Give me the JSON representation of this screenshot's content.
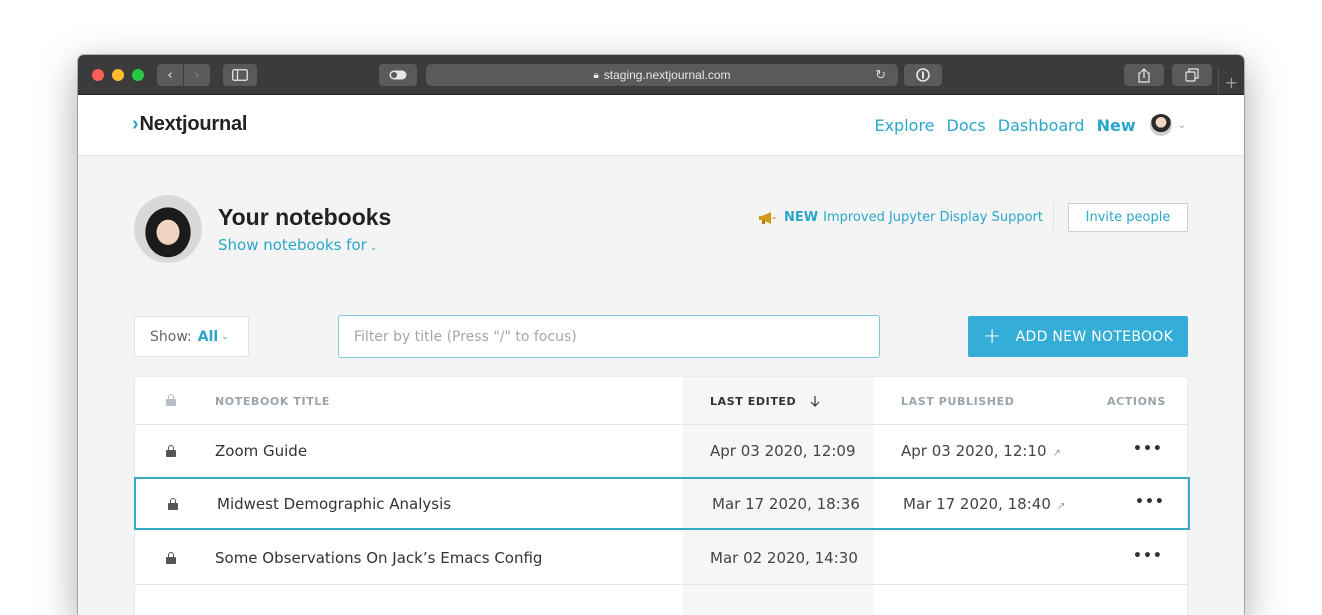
{
  "browser": {
    "url": "staging.nextjournal.com"
  },
  "header": {
    "logo_chevron": "›",
    "logo": "Nextjournal",
    "nav": {
      "explore": "Explore",
      "docs": "Docs",
      "dashboard": "Dashboard",
      "new": "New"
    }
  },
  "profile": {
    "title": "Your notebooks",
    "subtitle": "Show notebooks for"
  },
  "announcement": {
    "tag": "NEW",
    "text": "Improved Jupyter Display Support"
  },
  "invite_label": "Invite people",
  "toolbar": {
    "show_label": "Show:",
    "show_value": "All",
    "search_placeholder": "Filter by title (Press \"/\" to focus)",
    "add_label": "ADD NEW NOTEBOOK"
  },
  "table": {
    "columns": {
      "title": "NOTEBOOK TITLE",
      "last_edited": "LAST EDITED",
      "last_published": "LAST PUBLISHED",
      "actions": "ACTIONS"
    },
    "rows": [
      {
        "title": "Zoom Guide",
        "last_edited": "Apr 03 2020, 12:09",
        "last_published": "Apr 03 2020, 12:10",
        "actions": "•••"
      },
      {
        "title": "Midwest Demographic Analysis",
        "last_edited": "Mar 17 2020, 18:36",
        "last_published": "Mar 17 2020, 18:40",
        "actions": "•••"
      },
      {
        "title": "Some Observations On Jack’s Emacs Config",
        "last_edited": "Mar 02 2020, 14:30",
        "last_published": "",
        "actions": "•••"
      }
    ]
  },
  "icons": {
    "lock": "lock-icon",
    "sort": "arrow-down-icon",
    "external": "external-link-icon",
    "megaphone": "megaphone-icon"
  },
  "colors": {
    "accent": "#2ba6cb",
    "button": "#34aed6",
    "selected_border": "#3aa9c9"
  }
}
